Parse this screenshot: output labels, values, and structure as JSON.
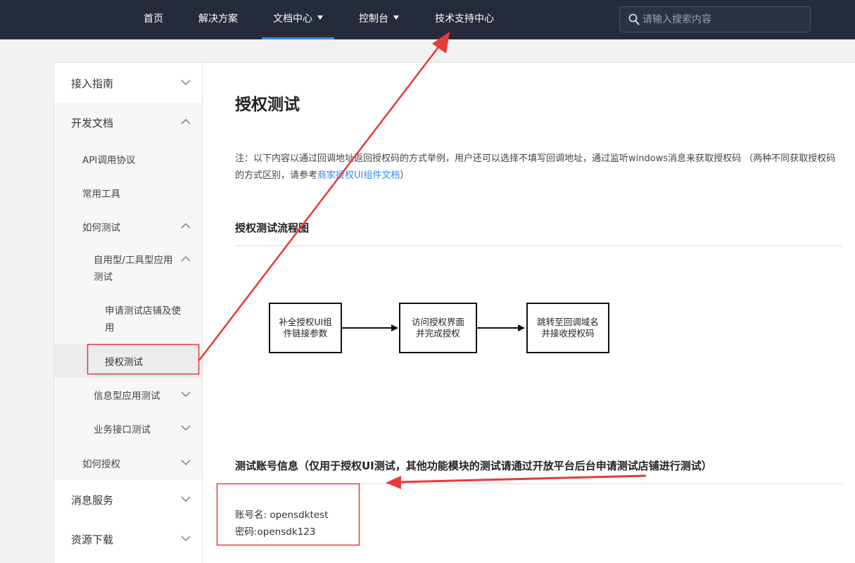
{
  "nav": {
    "items": [
      {
        "label": "首页"
      },
      {
        "label": "解决方案"
      },
      {
        "label": "文档中心"
      },
      {
        "label": "控制台"
      },
      {
        "label": "技术支持中心"
      }
    ],
    "active": "文档中心",
    "search_placeholder": "请输入搜索内容"
  },
  "sidebar": {
    "access_guide": "接入指南",
    "dev_docs": "开发文档",
    "api_protocol": "API调用协议",
    "common_tools": "常用工具",
    "how_to_test": "如何测试",
    "self_use_test_line1": "自用型/工具型应用",
    "self_use_test_line2": "测试",
    "apply_shop_line1": "申请测试店铺及使",
    "apply_shop_line2": "用",
    "auth_test": "授权测试",
    "info_app_test": "信息型应用测试",
    "biz_api_test": "业务接口测试",
    "how_to_auth": "如何授权",
    "message_service": "消息服务",
    "resource_download": "资源下载"
  },
  "main": {
    "title": "授权测试",
    "note_text": "注：以下内容以通过回调地址返回授权码的方式举例，用户还可以选择不填写回调地址，通过监听windows消息来获取授权码 （两种不同获取授权码的方式区别，请参考",
    "note_link": "商家授权UI组件文档",
    "note_end": "）",
    "flow_heading": "授权测试流程图",
    "flow_steps": [
      {
        "line1": "补全授权UI组",
        "line2": "件链接参数"
      },
      {
        "line1": "访问授权界面",
        "line2": "并完成授权"
      },
      {
        "line1": "跳转至回调域名",
        "line2": "并接收授权码"
      }
    ],
    "account_heading": "测试账号信息（仅用于授权UI测试，其他功能模块的测试请通过开放平台后台申请测试店铺进行测试）",
    "account_name": "账号名: opensdktest",
    "account_password": "密码:opensdk123"
  },
  "colors": {
    "nav_bg": "#252b3a",
    "accent": "#2c8df4",
    "annotation_red": "#e8393b"
  }
}
